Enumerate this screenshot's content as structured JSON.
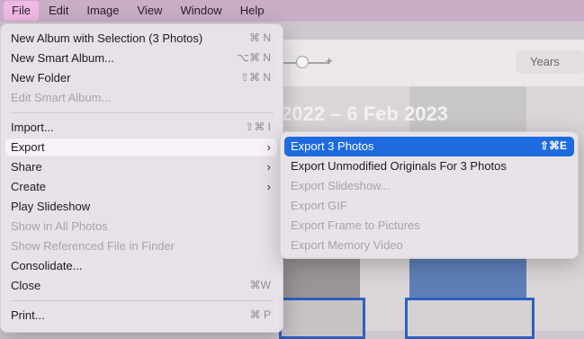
{
  "menubar": {
    "items": [
      "File",
      "Edit",
      "Image",
      "View",
      "Window",
      "Help"
    ]
  },
  "window": {
    "years_label": "Years",
    "date_range": "2022 – 6 Feb 2023",
    "plus_label": "+"
  },
  "file_menu": {
    "items": [
      {
        "label": "New Album with Selection (3 Photos)",
        "shortcut": "⌘ N"
      },
      {
        "label": "New Smart Album...",
        "shortcut": "⌥⌘ N"
      },
      {
        "label": "New Folder",
        "shortcut": "⇧⌘ N"
      },
      {
        "label": "Edit Smart Album...",
        "shortcut": ""
      },
      {
        "label": "Import...",
        "shortcut": "⇧⌘ I"
      },
      {
        "label": "Export",
        "shortcut": ""
      },
      {
        "label": "Share",
        "shortcut": ""
      },
      {
        "label": "Create",
        "shortcut": ""
      },
      {
        "label": "Play Slideshow",
        "shortcut": ""
      },
      {
        "label": "Show in All Photos",
        "shortcut": ""
      },
      {
        "label": "Show Referenced File in Finder",
        "shortcut": ""
      },
      {
        "label": "Consolidate...",
        "shortcut": ""
      },
      {
        "label": "Close",
        "shortcut": "⌘W"
      },
      {
        "label": "Print...",
        "shortcut": "⌘ P"
      }
    ]
  },
  "export_menu": {
    "items": [
      {
        "label": "Export 3 Photos",
        "shortcut": "⇧⌘E"
      },
      {
        "label": "Export Unmodified Originals For 3 Photos",
        "shortcut": ""
      },
      {
        "label": "Export Slideshow...",
        "shortcut": ""
      },
      {
        "label": "Export GIF",
        "shortcut": ""
      },
      {
        "label": "Export Frame to Pictures",
        "shortcut": ""
      },
      {
        "label": "Export Memory Video",
        "shortcut": ""
      }
    ]
  },
  "icons": {
    "submenu_chevron": "›"
  }
}
